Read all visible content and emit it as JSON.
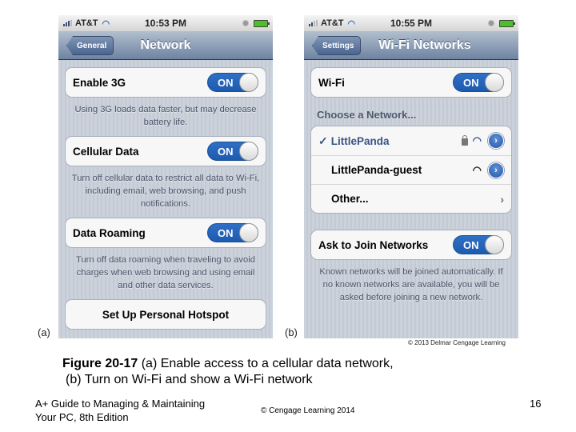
{
  "phone_a": {
    "status": {
      "carrier": "AT&T",
      "time": "10:53 PM"
    },
    "nav": {
      "back_label": "General",
      "title": "Network"
    },
    "settings": [
      {
        "label": "Enable 3G",
        "state": "ON",
        "footnote": "Using 3G loads data faster, but may decrease battery life."
      },
      {
        "label": "Cellular Data",
        "state": "ON",
        "footnote": "Turn off cellular data to restrict all data to Wi-Fi, including email, web browsing, and push notifications."
      },
      {
        "label": "Data Roaming",
        "state": "ON",
        "footnote": "Turn off data roaming when traveling to avoid charges when web browsing and using email and other data services."
      }
    ],
    "hotspot_label": "Set Up Personal Hotspot"
  },
  "phone_b": {
    "status": {
      "carrier": "AT&T",
      "time": "10:55 PM"
    },
    "nav": {
      "back_label": "Settings",
      "title": "Wi-Fi Networks"
    },
    "wifi": {
      "label": "Wi-Fi",
      "state": "ON"
    },
    "choose_header": "Choose a Network...",
    "networks": [
      {
        "name": "LittlePanda",
        "selected": true,
        "secured": true
      },
      {
        "name": "LittlePanda-guest",
        "selected": false,
        "secured": false
      },
      {
        "name": "Other...",
        "selected": false,
        "secured": false
      }
    ],
    "ask_join": {
      "label": "Ask to Join Networks",
      "state": "ON",
      "footnote": "Known networks will be joined automatically. If no known networks are available, you will be asked before joining a new network."
    }
  },
  "figure": {
    "letter_a": "(a)",
    "letter_b": "(b)",
    "credit": "© 2013 Delmar Cengage Learning",
    "caption_bold": "Figure 20-17",
    "caption_line1": " (a) Enable access to a cellular data network,",
    "caption_line2": "(b) Turn on Wi-Fi and show a Wi-Fi network"
  },
  "footer": {
    "book_line1": "A+ Guide to Managing & Maintaining",
    "book_line2": "Your PC, 8th Edition",
    "copyright": "© Cengage Learning 2014",
    "page_number": "16"
  },
  "colors": {
    "toggle_on": "#1d5bb0",
    "selected_network": "#385487",
    "navbar": "#6d83a2"
  }
}
